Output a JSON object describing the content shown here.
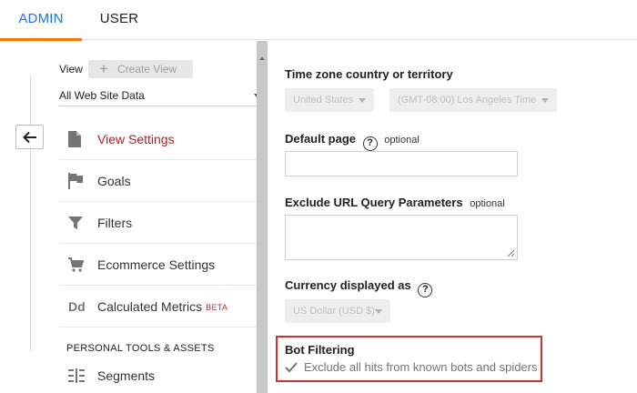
{
  "tabs": {
    "admin": "ADMIN",
    "user": "USER"
  },
  "sidebar": {
    "view_label": "View",
    "create_view": "Create View",
    "selected_view": "All Web Site Data",
    "items": [
      {
        "label": "View Settings",
        "icon": "document-icon",
        "active": true
      },
      {
        "label": "Goals",
        "icon": "flag-icon"
      },
      {
        "label": "Filters",
        "icon": "filter-icon"
      },
      {
        "label": "Ecommerce Settings",
        "icon": "cart-icon"
      },
      {
        "label": "Calculated Metrics",
        "icon": "dd-icon",
        "badge": "BETA"
      }
    ],
    "section_heading": "PERSONAL TOOLS & ASSETS",
    "segments_label": "Segments",
    "dd_icon_text": "Dd"
  },
  "settings": {
    "timezone_label": "Time zone country or territory",
    "timezone_country": "United States",
    "timezone_zone": "(GMT-08:00) Los Angeles Time",
    "default_page_label": "Default page",
    "default_page_optional": "optional",
    "default_page_value": "",
    "exclude_label": "Exclude URL Query Parameters",
    "exclude_optional": "optional",
    "exclude_value": "",
    "currency_label": "Currency displayed as",
    "currency_value": "US Dollar (USD $)",
    "help_symbol": "?",
    "bot_filtering_label": "Bot Filtering",
    "bot_filtering_text": "Exclude all hits from known bots and spiders",
    "bot_filtering_checked": true
  },
  "colors": {
    "accent_blue": "#1a73e8",
    "tab_underline": "#f57c00",
    "active_red": "#b71c1c",
    "highlight_border": "#d32f2f"
  }
}
